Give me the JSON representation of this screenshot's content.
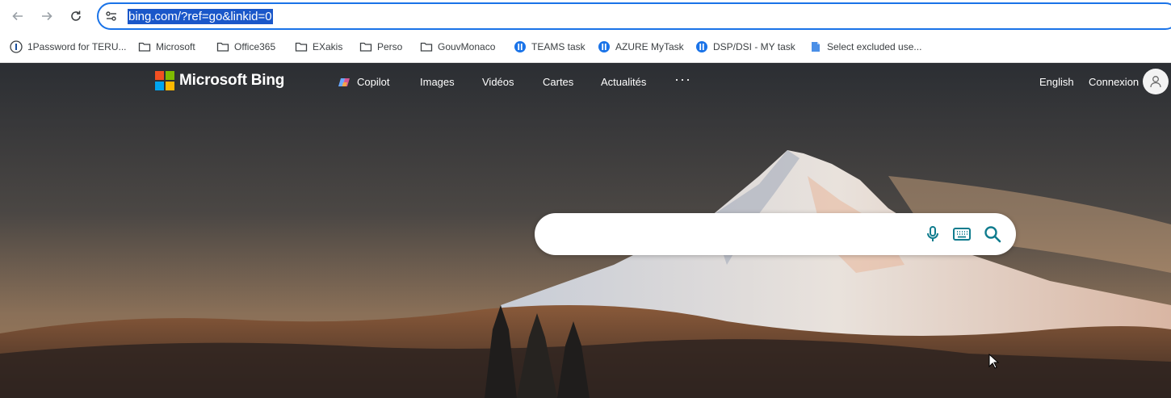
{
  "browser": {
    "url": "bing.com/?ref=go&linkid=0",
    "bookmarks": [
      {
        "label": "1Password for TERU...",
        "icon": "password-icon"
      },
      {
        "label": "Microsoft",
        "icon": "folder-icon"
      },
      {
        "label": "Office365",
        "icon": "folder-icon"
      },
      {
        "label": "EXakis",
        "icon": "folder-icon"
      },
      {
        "label": "Perso",
        "icon": "folder-icon"
      },
      {
        "label": "GouvMonaco",
        "icon": "folder-icon"
      },
      {
        "label": "TEAMS task",
        "icon": "task-icon"
      },
      {
        "label": "AZURE MyTask",
        "icon": "task-icon"
      },
      {
        "label": "DSP/DSI - MY task",
        "icon": "task-icon"
      },
      {
        "label": "Select excluded use...",
        "icon": "page-icon"
      }
    ]
  },
  "bing": {
    "brand": "Microsoft Bing",
    "nav": {
      "copilot": "Copilot",
      "images": "Images",
      "videos": "Vidéos",
      "maps": "Cartes",
      "news": "Actualités",
      "more": "···"
    },
    "language": "English",
    "signin": "Connexion",
    "search": {
      "placeholder": ""
    }
  },
  "colors": {
    "accent": "#1a73e8",
    "url_highlight": "#1a57c9",
    "bing_teal": "#107c8e",
    "ms_red": "#f25022",
    "ms_green": "#7fba00",
    "ms_blue": "#00a4ef",
    "ms_yellow": "#ffb900"
  }
}
